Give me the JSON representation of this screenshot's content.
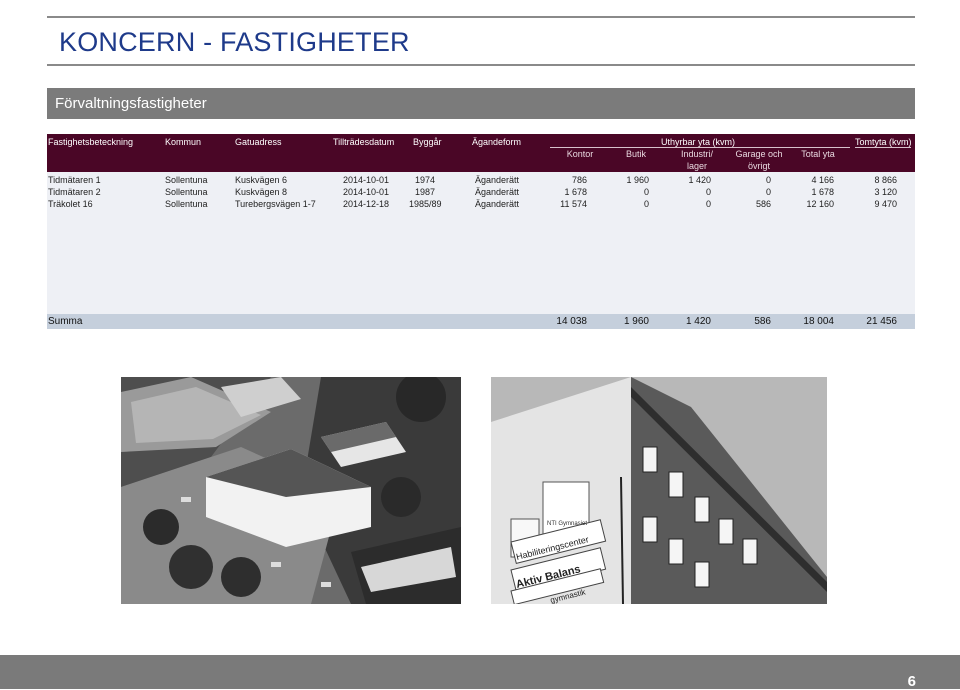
{
  "title": "KONCERN - FASTIGHETER",
  "section": "Förvaltningsfastigheter",
  "table": {
    "headers": {
      "fastighet": "Fastighetsbeteckning",
      "kommun": "Kommun",
      "gatuadress": "Gatuadress",
      "tilltrade": "Tillträdesdatum",
      "byggar": "Byggår",
      "agandeform": "Ägandeform",
      "uthyrbar": "Uthyrbar yta (kvm)",
      "tomtyta": "Tomtyta (kvm)"
    },
    "subheaders": {
      "kontor": "Kontor",
      "butik": "Butik",
      "industri_1": "Industri/",
      "industri_2": "lager",
      "garage_1": "Garage och",
      "garage_2": "övrigt",
      "total": "Total yta"
    },
    "rows": [
      {
        "fastighet": "Tidmätaren 1",
        "kommun": "Sollentuna",
        "gatuadress": "Kuskvägen 6",
        "tilltrade": "2014-10-01",
        "byggar": "1974",
        "agandeform": "Äganderätt",
        "kontor": "786",
        "butik": "1 960",
        "industri": "1 420",
        "garage": "0",
        "total": "4 166",
        "tomtyta": "8 866"
      },
      {
        "fastighet": "Tidmätaren 2",
        "kommun": "Sollentuna",
        "gatuadress": "Kuskvägen 8",
        "tilltrade": "2014-10-01",
        "byggar": "1987",
        "agandeform": "Äganderätt",
        "kontor": "1 678",
        "butik": "0",
        "industri": "0",
        "garage": "0",
        "total": "1 678",
        "tomtyta": "3 120"
      },
      {
        "fastighet": "Träkolet 16",
        "kommun": "Sollentuna",
        "gatuadress": "Turebergsvägen 1-7",
        "tilltrade": "2014-12-18",
        "byggar": "1985/89",
        "agandeform": "Äganderätt",
        "kontor": "11 574",
        "butik": "0",
        "industri": "0",
        "garage": "586",
        "total": "12 160",
        "tomtyta": "9 470"
      }
    ],
    "summary": {
      "label": "Summa",
      "kontor": "14 038",
      "butik": "1 960",
      "industri": "1 420",
      "garage": "586",
      "total": "18 004",
      "tomtyta": "21 456"
    }
  },
  "photos": {
    "sign_1": "NTI Gymnasiet",
    "sign_2": "Habiliteringscenter",
    "sign_3": "Aktiv Balans",
    "sign_4": "gymnastik"
  },
  "page_number": "6"
}
